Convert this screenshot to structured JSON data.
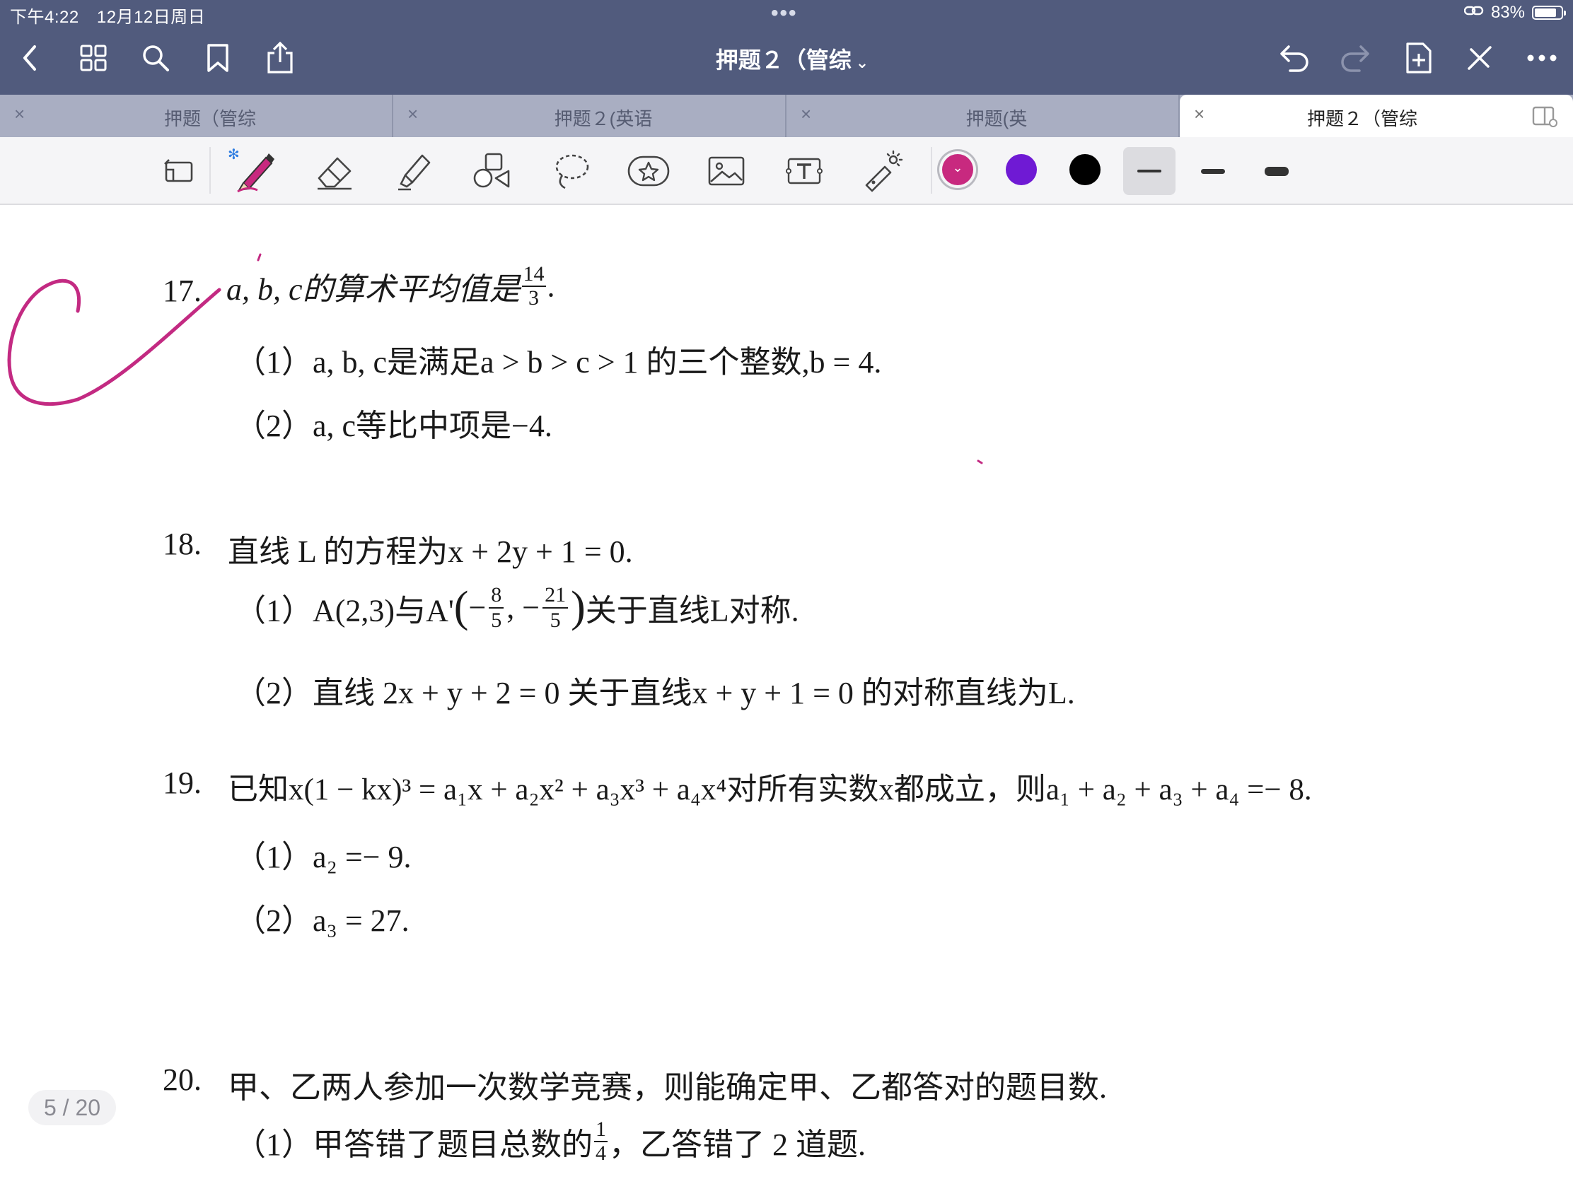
{
  "status_bar": {
    "time": "下午4:22",
    "date": "12月12日周日",
    "battery_text": "83%",
    "battery_level": 0.83,
    "multitask_dots": "•••"
  },
  "nav": {
    "title": "押题２（管综",
    "title_chevron": "⌄"
  },
  "tabs": [
    {
      "label": "押题（管综",
      "close": "×",
      "active": false
    },
    {
      "label": "押题２(英语",
      "close": "×",
      "active": false
    },
    {
      "label": "押题(英",
      "close": "×",
      "active": false
    },
    {
      "label": "押题２（管综",
      "close": "×",
      "active": true
    }
  ],
  "toolbar": {
    "colors": [
      "#c8297f",
      "#6f1ad4",
      "#000000"
    ],
    "selected_color": "#c8297f",
    "swatch_chevron": "⌄",
    "bluetooth_icon": "✻"
  },
  "document": {
    "q17": {
      "num": "17.",
      "stem": "a, b, c的算术平均值是",
      "frac_num": "14",
      "frac_den": "3",
      "stem_end": ".",
      "opt1": "（1）a, b, c是满足a > b > c > 1 的三个整数,b = 4.",
      "opt2": "（2）a, c等比中项是−4."
    },
    "q18": {
      "num": "18.",
      "stem": "直线 L 的方程为x + 2y + 1 = 0.",
      "opt1_a": "（1）A(2,3)与A'",
      "opt1_f1n": "8",
      "opt1_f1d": "5",
      "opt1_f2n": "21",
      "opt1_f2d": "5",
      "opt1_b": "关于直线L对称.",
      "opt2": "（2）直线 2x + y + 2 = 0 关于直线x + y + 1 = 0 的对称直线为L."
    },
    "q19": {
      "num": "19.",
      "stem": "已知x(1 − kx)³ = a₁x + a₂x² + a₃x³ + a₄x⁴对所有实数x都成立，则a₁ + a₂ + a₃ + a₄ =− 8.",
      "opt1": "（1）a₂ =− 9.",
      "opt2": "（2）a₃ = 27."
    },
    "q20": {
      "num": "20.",
      "stem": "甲、乙两人参加一次数学竞赛，则能确定甲、乙都答对的题目数.",
      "opt1_a": "（1）甲答错了题目总数的",
      "opt1_fn": "1",
      "opt1_fd": "4",
      "opt1_b": "，乙答错了 2 道题."
    }
  },
  "page_indicator": "5 / 20"
}
